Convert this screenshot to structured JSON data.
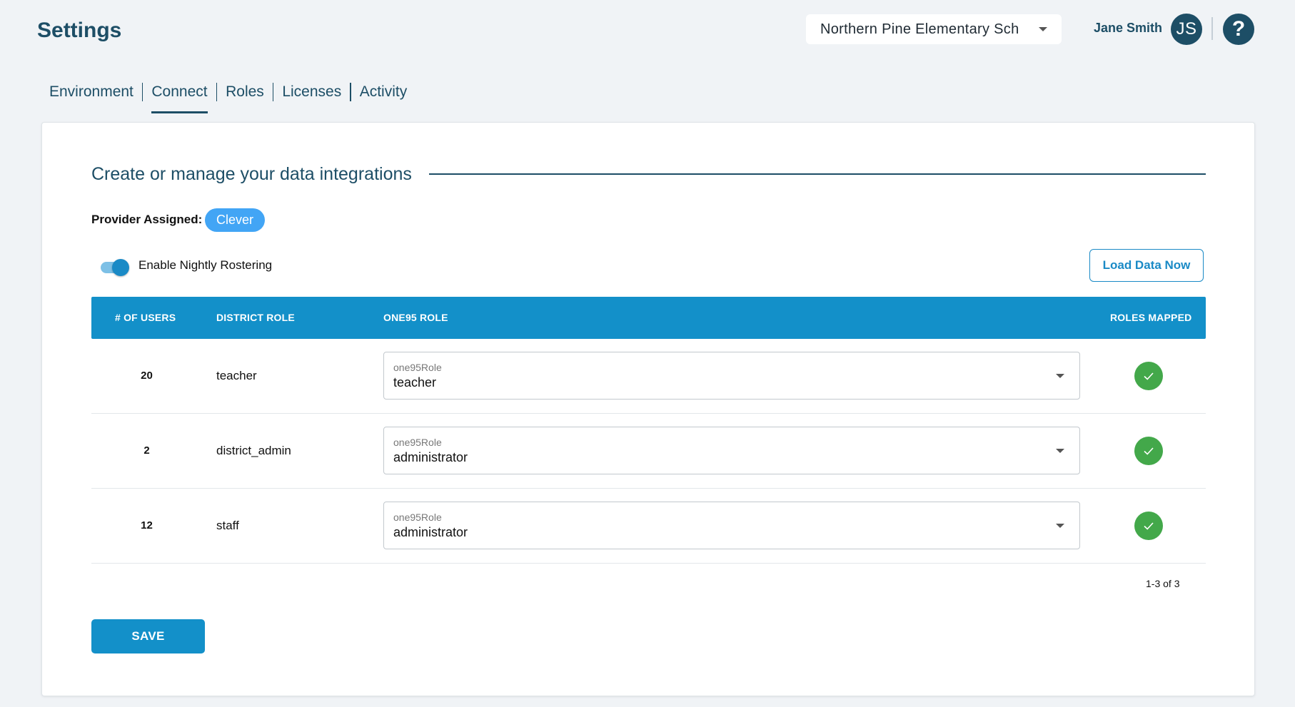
{
  "header": {
    "title": "Settings",
    "school_select": "Northern Pine Elementary Sch",
    "user_name": "Jane Smith",
    "avatar_initials": "JS",
    "help_icon": "?"
  },
  "tabs": [
    {
      "label": "Environment",
      "active": false
    },
    {
      "label": "Connect",
      "active": true
    },
    {
      "label": "Roles",
      "active": false
    },
    {
      "label": "Licenses",
      "active": false
    },
    {
      "label": "Activity",
      "active": false
    }
  ],
  "card": {
    "title": "Create or manage your data integrations",
    "provider_label": "Provider Assigned:",
    "provider_value": "Clever",
    "toggle_label": "Enable Nightly Rostering",
    "toggle_on": true,
    "load_button": "Load Data Now"
  },
  "table": {
    "headers": {
      "users": "# OF USERS",
      "district_role": "DISTRICT ROLE",
      "one95_role": "ONE95 ROLE",
      "roles_mapped": "ROLES MAPPED"
    },
    "select_label": "one95Role",
    "rows": [
      {
        "users": "20",
        "district_role": "teacher",
        "one95_role": "teacher",
        "mapped": true
      },
      {
        "users": "2",
        "district_role": "district_admin",
        "one95_role": "administrator",
        "mapped": true
      },
      {
        "users": "12",
        "district_role": "staff",
        "one95_role": "administrator",
        "mapped": true
      }
    ],
    "pagination": "1-3 of 3"
  },
  "save_button": "SAVE",
  "colors": {
    "brand_dark": "#1d4e66",
    "primary": "#1390c9",
    "chip": "#42a5f5",
    "success": "#43a84a"
  }
}
